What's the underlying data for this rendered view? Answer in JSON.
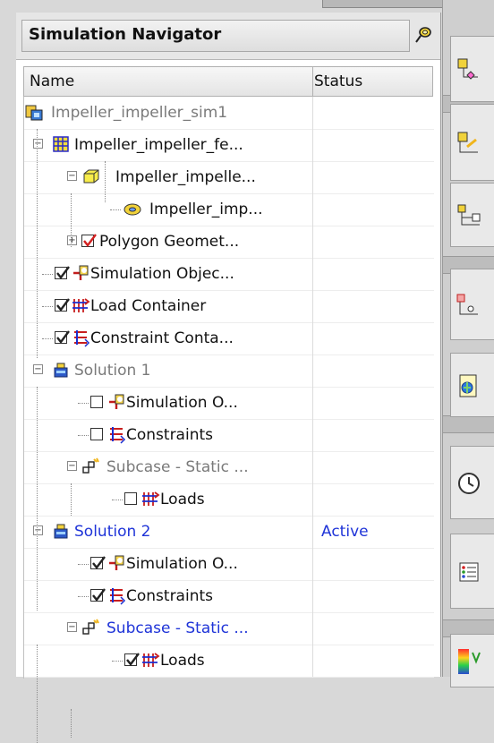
{
  "navigator": {
    "title": "Simulation Navigator",
    "pin_icon": "pin-icon",
    "columns": {
      "name": "Name",
      "status": "Status"
    },
    "nodes": [
      {
        "label": "Impeller_impeller_sim1",
        "status": "",
        "icon": "sim-file-icon",
        "checkbox": null,
        "expander": null,
        "style": "gray"
      },
      {
        "label": "Impeller_impeller_fe...",
        "status": "",
        "icon": "fem-mesh-icon",
        "checkbox": null,
        "expander": "collapse",
        "style": "normal"
      },
      {
        "label": "Impeller_impelle...",
        "status": "",
        "icon": "polygon-body-icon",
        "checkbox": null,
        "expander": "collapse",
        "style": "normal"
      },
      {
        "label": "Impeller_imp...",
        "status": "",
        "icon": "part-icon",
        "checkbox": null,
        "expander": null,
        "style": "normal"
      },
      {
        "label": "Polygon Geomet...",
        "status": "",
        "icon": "",
        "checkbox": "checked-red",
        "expander": "expand",
        "style": "normal"
      },
      {
        "label": "Simulation Objec...",
        "status": "",
        "icon": "simulation-object-icon",
        "checkbox": "checked",
        "expander": null,
        "style": "normal"
      },
      {
        "label": "Load Container",
        "status": "",
        "icon": "load-container-icon",
        "checkbox": "checked",
        "expander": null,
        "style": "normal"
      },
      {
        "label": "Constraint Conta...",
        "status": "",
        "icon": "constraint-icon",
        "checkbox": "checked",
        "expander": null,
        "style": "normal"
      },
      {
        "label": "Solution 1",
        "status": "",
        "icon": "solution-icon",
        "checkbox": null,
        "expander": "collapse",
        "style": "gray"
      },
      {
        "label": "Simulation O...",
        "status": "",
        "icon": "simulation-object-icon",
        "checkbox": "unchecked",
        "expander": null,
        "style": "normal"
      },
      {
        "label": "Constraints",
        "status": "",
        "icon": "constraint-icon",
        "checkbox": "unchecked",
        "expander": null,
        "style": "normal"
      },
      {
        "label": "Subcase - Static ...",
        "status": "",
        "icon": "subcase-icon",
        "checkbox": null,
        "expander": "collapse",
        "style": "gray"
      },
      {
        "label": "Loads",
        "status": "",
        "icon": "load-container-icon",
        "checkbox": "unchecked",
        "expander": null,
        "style": "normal"
      },
      {
        "label": "Solution 2",
        "status": "Active",
        "icon": "solution-icon",
        "checkbox": null,
        "expander": "collapse",
        "style": "blue"
      },
      {
        "label": "Simulation O...",
        "status": "",
        "icon": "simulation-object-icon",
        "checkbox": "checked",
        "expander": null,
        "style": "normal"
      },
      {
        "label": "Constraints",
        "status": "",
        "icon": "constraint-icon",
        "checkbox": "checked",
        "expander": null,
        "style": "normal"
      },
      {
        "label": "Subcase - Static ...",
        "status": "",
        "icon": "subcase-icon",
        "checkbox": null,
        "expander": "collapse",
        "style": "blue"
      },
      {
        "label": "Loads",
        "status": "",
        "icon": "load-container-icon",
        "checkbox": "checked",
        "expander": null,
        "style": "normal"
      }
    ]
  },
  "right_toolbar": {
    "buttons": [
      {
        "icon": "part-navigator-icon"
      },
      {
        "icon": "assembly-navigator-icon"
      },
      {
        "icon": "constraint-navigator-icon"
      },
      {
        "icon": "part-history-icon"
      },
      {
        "icon": "document-web-icon"
      },
      {
        "icon": "clock-history-icon"
      },
      {
        "icon": "list-roles-icon"
      },
      {
        "icon": "palette-icon"
      }
    ]
  },
  "colors": {
    "active_blue": "#1f34d8",
    "inactive_gray": "#7a7a7a",
    "check_red": "#d22020"
  }
}
